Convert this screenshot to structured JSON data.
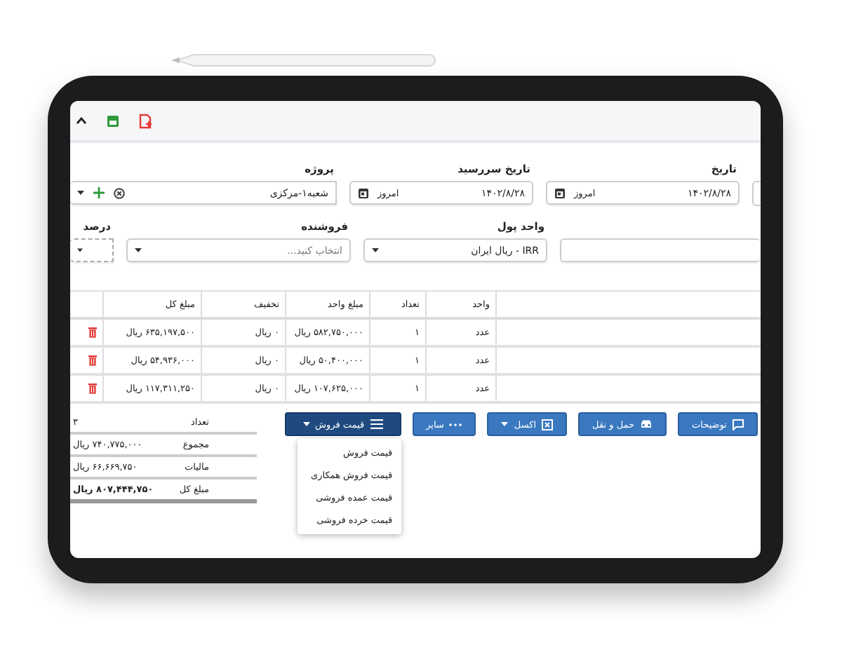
{
  "form": {
    "row1": [
      {
        "kind": "date",
        "label": "تاریخ",
        "value": "۱۴۰۲/۸/۲۸",
        "button": "امروز"
      },
      {
        "kind": "date",
        "label": "تاریخ سررسید",
        "value": "۱۴۰۲/۸/۲۸",
        "button": "امروز"
      },
      {
        "kind": "lookup",
        "label": "پروژه",
        "value": "شعبه۱-مرکزی"
      }
    ],
    "row2": [
      {
        "kind": "blank"
      },
      {
        "kind": "select",
        "label": "واحد پول",
        "value": "IRR - ریال ایران"
      },
      {
        "kind": "select",
        "label": "فروشنده",
        "placeholder": "انتخاب کنید..."
      },
      {
        "kind": "percent",
        "label": "درصد"
      }
    ]
  },
  "table": {
    "columns": [
      "واحد",
      "تعداد",
      "مبلغ واحد",
      "تخفیف",
      "مبلغ کل"
    ],
    "rows": [
      {
        "cells": [
          "عدد",
          "۱",
          "۵۸۲,۷۵۰,۰۰۰ ریال",
          "۰ ریال",
          "۶۳۵,۱۹۷,۵۰۰ ریال"
        ]
      },
      {
        "cells": [
          "عدد",
          "۱",
          "۵۰,۴۰۰,۰۰۰ ریال",
          "۰ ریال",
          "۵۴,۹۳۶,۰۰۰ ریال"
        ]
      },
      {
        "cells": [
          "عدد",
          "۱",
          "۱۰۷,۶۲۵,۰۰۰ ریال",
          "۰ ریال",
          "۱۱۷,۳۱۱,۲۵۰ ریال"
        ]
      }
    ]
  },
  "buttons": [
    {
      "kind": "comment",
      "label": "توضیحات",
      "selected": false
    },
    {
      "kind": "car",
      "label": "حمل و نقل",
      "selected": false
    },
    {
      "kind": "excel",
      "label": "اکسل",
      "selected": false
    },
    {
      "kind": "more",
      "label": "سایر",
      "selected": false
    },
    {
      "kind": "price",
      "label": "قیمت فروش",
      "selected": true
    }
  ],
  "price_menu": {
    "items": [
      "قیمت فروش",
      "قیمت فروش همکاری",
      "قیمت عمده فروشی",
      "قیمت خرده فروشی"
    ]
  },
  "totals": [
    {
      "label": "تعداد",
      "value": "۳",
      "bold": false
    },
    {
      "label": "مجموع",
      "value": "۷۴۰,۷۷۵,۰۰۰ ریال",
      "bold": false
    },
    {
      "label": "مالیات",
      "value": "۶۶,۶۶۹,۷۵۰ ریال",
      "bold": false
    },
    {
      "label": "مبلغ کل",
      "value": "۸۰۷,۴۴۴,۷۵۰ ریال",
      "bold": true
    }
  ]
}
